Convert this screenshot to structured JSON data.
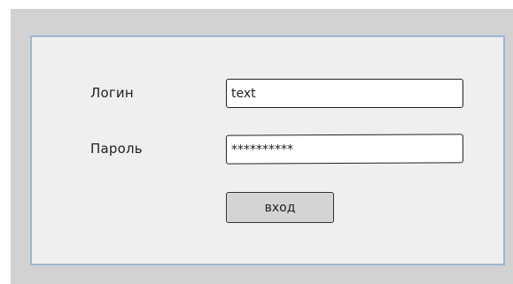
{
  "form": {
    "login_label": "Логин",
    "login_value": "text",
    "password_label": "Пароль",
    "password_value": "**********",
    "submit_label": "вход"
  },
  "colors": {
    "backdrop": "#d2d2d2",
    "dialog_background": "#efefef",
    "dialog_border": "#9fb6cf",
    "button_background": "#d4d4d4"
  }
}
